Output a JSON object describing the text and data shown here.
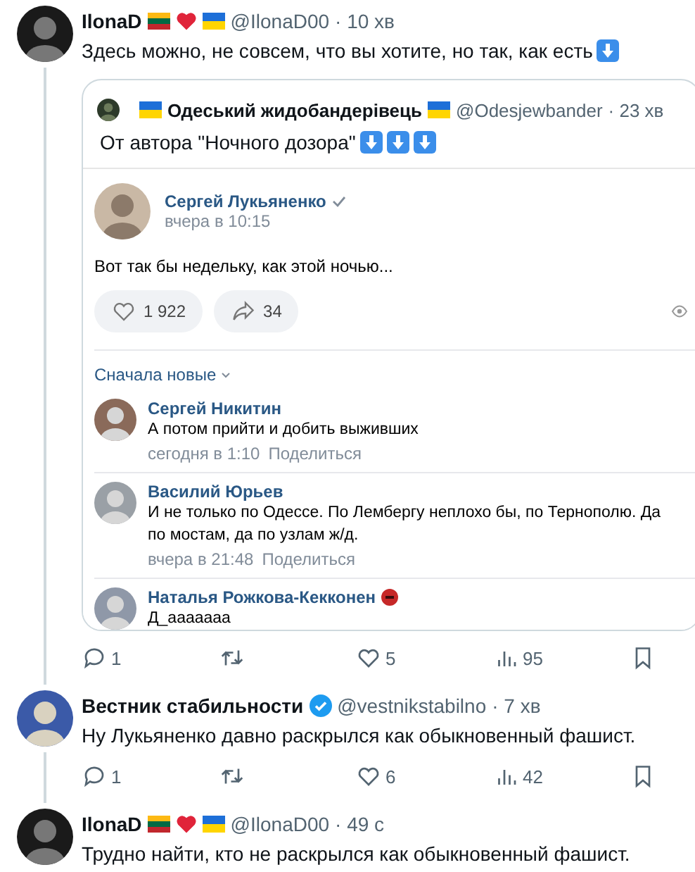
{
  "tweets": [
    {
      "author": "IlonaD",
      "badges": [
        {
          "kind": "flag-lt"
        },
        {
          "kind": "heart"
        },
        {
          "kind": "flag-ua"
        }
      ],
      "handle": "@IlonaD00",
      "time": "· 10 хв",
      "verified": false,
      "text": "Здесь можно, не совсем, что вы хотите, но так, как есть",
      "text_icons": [
        {
          "kind": "down-arrow"
        }
      ],
      "quote": {
        "author": "Одеський жидобандерівець",
        "prefix_badges": [
          {
            "kind": "flag-ua"
          }
        ],
        "badges": [
          {
            "kind": "flag-ua"
          }
        ],
        "handle": "@Odesjewbander",
        "time": "· 23 хв",
        "text": "От автора \"Ночного дозора\"",
        "text_icons": [
          {
            "kind": "down-arrow"
          },
          {
            "kind": "down-arrow"
          },
          {
            "kind": "down-arrow"
          }
        ],
        "image": {
          "kind": "screenshot",
          "post": {
            "author": "Сергей Лукьяненко",
            "verified": true,
            "time": "вчера в 10:15",
            "text": "Вот так бы недельку, как этой ночью...",
            "buttons": [
              {
                "kind": "like",
                "count": "1 922"
              },
              {
                "kind": "share",
                "count": "34"
              }
            ]
          },
          "sort": "Сначала новые",
          "comments": [
            {
              "name": "Сергей Никитин",
              "text": "А потом прийти и добить выживших",
              "time": "сегодня в 1:10",
              "action": "Поделиться"
            },
            {
              "name": "Василий Юрьев",
              "text": "И не только по Одессе. По Лембергу неплохо бы, по Тернополю. Да по мостам, да по узлам ж/д.",
              "time": "вчера в 21:48",
              "action": "Поделиться"
            },
            {
              "name": "Наталья Рожкова-Кекконен",
              "badges": [
                {
                  "kind": "emoji"
                }
              ],
              "text": "Д_ааааааа"
            }
          ]
        }
      },
      "actions": [
        {
          "kind": "reply",
          "count": "1"
        },
        {
          "kind": "retweet"
        },
        {
          "kind": "like",
          "count": "5"
        },
        {
          "kind": "views",
          "count": "95"
        },
        {
          "kind": "bookmark"
        }
      ]
    },
    {
      "author": "Вестник стабильности",
      "handle": "@vestnikstabilno",
      "time": "· 7 хв",
      "verified": true,
      "text": "Ну Лукьяненко давно раскрылся как обыкновенный фашист.",
      "actions": [
        {
          "kind": "reply",
          "count": "1"
        },
        {
          "kind": "retweet"
        },
        {
          "kind": "like",
          "count": "6"
        },
        {
          "kind": "views",
          "count": "42"
        },
        {
          "kind": "bookmark"
        }
      ]
    },
    {
      "author": "IlonaD",
      "badges": [
        {
          "kind": "flag-lt"
        },
        {
          "kind": "heart"
        },
        {
          "kind": "flag-ua"
        }
      ],
      "handle": "@IlonaD00",
      "time": "· 49 с",
      "verified": false,
      "text": "Трудно найти, кто не раскрылся как обыкновенный фашист."
    }
  ]
}
